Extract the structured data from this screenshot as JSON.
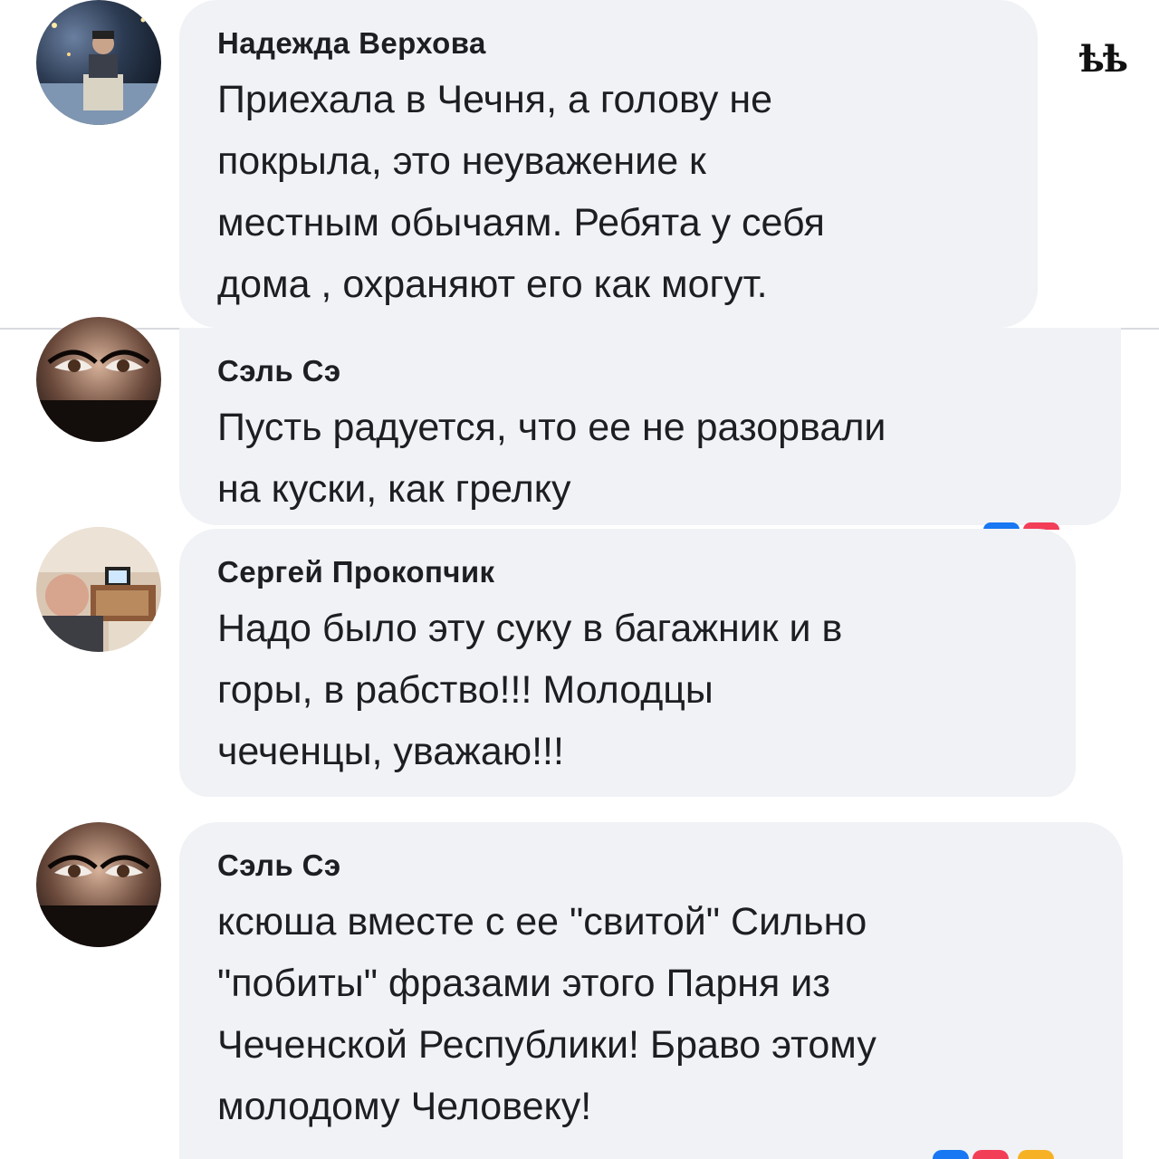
{
  "watermark": "ѣѣ",
  "comments": [
    {
      "author": "Надежда Верхова",
      "text": "Приехала в Чечня, а голову не\nпокрыла, это неуважение к\nместным обычаям. Ребята у себя\nдома , охраняют его как могут.",
      "avatar_icon": "person-photo-icon"
    },
    {
      "author": "Сэль Сэ",
      "text": "Пусть радуется, что ее не разорвали\nна куски, как грелку",
      "avatar_icon": "woman-eyes-photo-icon"
    },
    {
      "author": "Сергей Прокопчик",
      "text": "Надо было эту суку в багажник и в\nгоры, в рабство!!! Молодцы\nчеченцы, уважаю!!!",
      "avatar_icon": "man-in-room-photo-icon"
    },
    {
      "author": "Сэль Сэ",
      "text": "ксюша вместе с ее \"свитой\" Сильно\n\"побиты\" фразами этого Парня из\nЧеченской Республики! Браво этому\nмолодому Человеку!",
      "avatar_icon": "woman-eyes-photo-icon"
    }
  ],
  "colors": {
    "bubble": "#f0f2f5",
    "text": "#1c1e21",
    "like_reaction": "#1877f2",
    "love_reaction": "#f33e58",
    "haha_reaction": "#f7b125"
  }
}
